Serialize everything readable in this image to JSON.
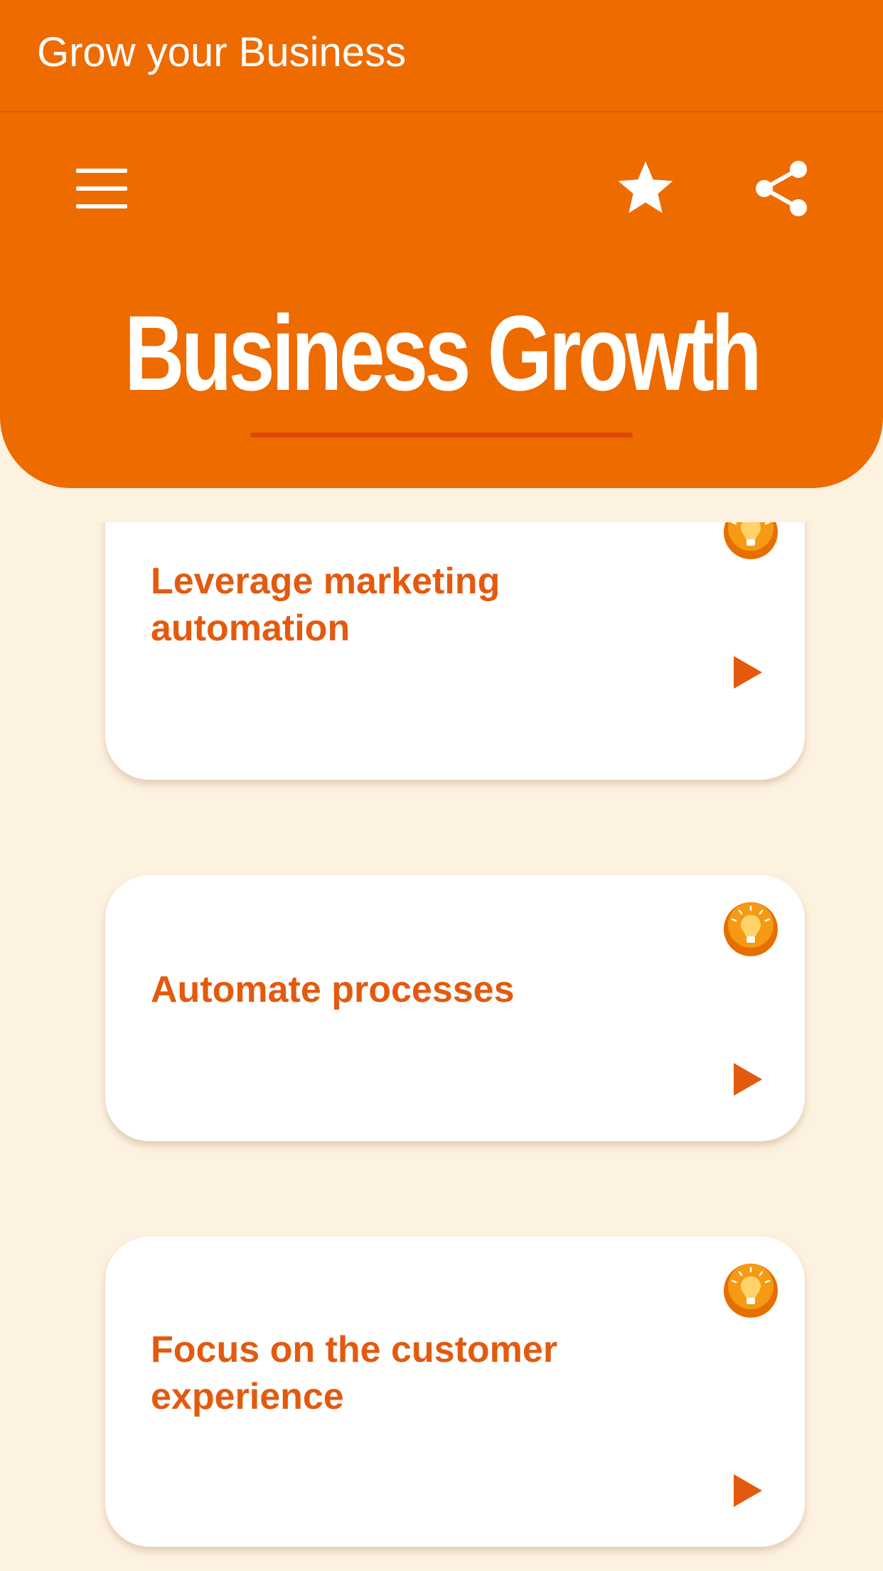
{
  "app_bar": {
    "title": "Grow your Business"
  },
  "header": {
    "menu_icon": "hamburger-menu-icon",
    "favorite_icon": "star-icon",
    "share_icon": "share-icon",
    "title": "Business Growth"
  },
  "cards": [
    {
      "title": "Leverage marketing automation",
      "icon": "lightbulb-icon",
      "action_icon": "play-icon"
    },
    {
      "title": "Automate processes",
      "icon": "lightbulb-icon",
      "action_icon": "play-icon"
    },
    {
      "title": "Focus on the customer experience",
      "icon": "lightbulb-icon",
      "action_icon": "play-icon"
    }
  ],
  "colors": {
    "primary": "#ee6b00",
    "accent_text": "#e35a0f",
    "underline": "#e0450c",
    "background": "#fdf1e0",
    "card": "#ffffff"
  }
}
